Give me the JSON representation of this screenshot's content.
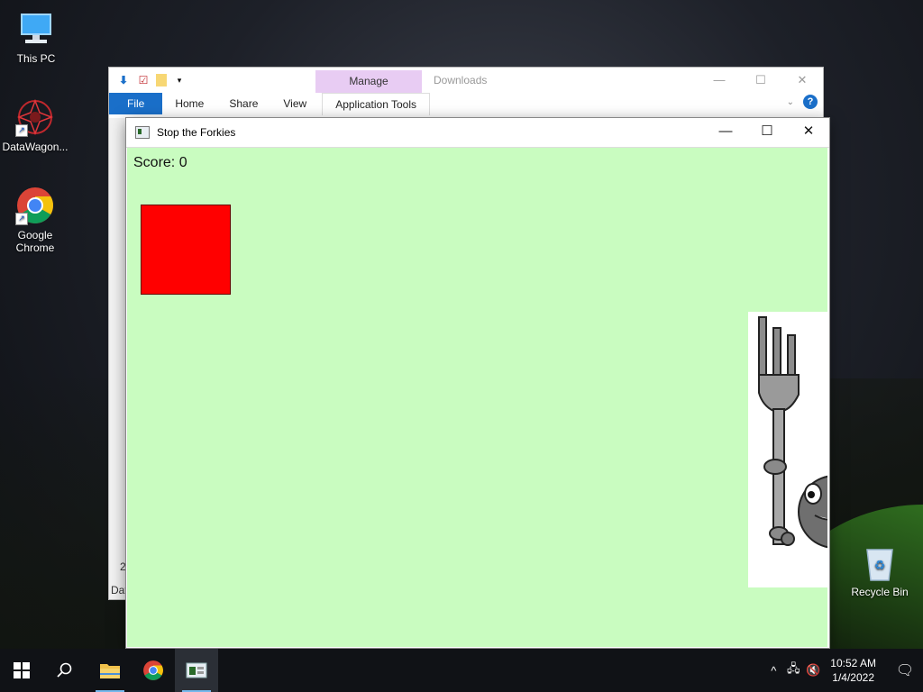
{
  "desktop": {
    "icons": [
      {
        "label": "This PC"
      },
      {
        "label": "DataWagon..."
      },
      {
        "label": "Google Chrome"
      },
      {
        "label": "Recycle Bin"
      }
    ]
  },
  "explorer": {
    "title": "Downloads",
    "manage_tab": "Manage",
    "ribbon_tabs": [
      "File",
      "Home",
      "Share",
      "View",
      "Application Tools"
    ],
    "min": "—",
    "max": "☐",
    "close": "✕",
    "fragment_1": "2",
    "fragment_2": "Dat"
  },
  "game": {
    "title": "Stop the Forkies",
    "min": "—",
    "max": "☐",
    "close": "✕",
    "score_label": "Score: 0",
    "background": "#c9fcc0",
    "player_color": "#ff0000"
  },
  "taskbar": {
    "time": "10:52 AM",
    "date": "1/4/2022",
    "apps": [
      "start-icon",
      "search-icon",
      "file-explorer-icon",
      "chrome-icon",
      "game-app-icon"
    ]
  }
}
